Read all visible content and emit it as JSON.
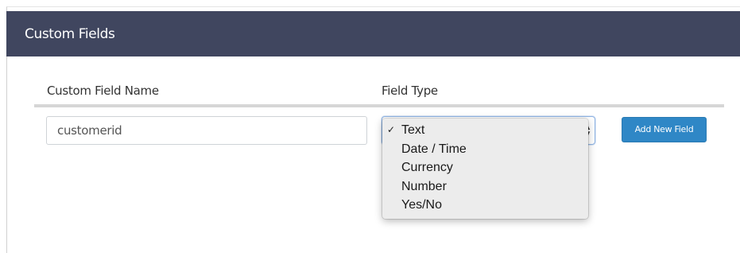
{
  "panel": {
    "title": "Custom Fields"
  },
  "table": {
    "headers": {
      "name": "Custom Field Name",
      "type": "Field Type"
    }
  },
  "row": {
    "name_value": "customerid",
    "add_button_label": "Add New Field"
  },
  "field_type_select": {
    "selected": "Text",
    "options": [
      "Text",
      "Date / Time",
      "Currency",
      "Number",
      "Yes/No"
    ],
    "check_glyph": "✓"
  },
  "colors": {
    "header_bg": "#40465f",
    "button_bg": "#2f87c6",
    "rule": "#d6d6d6"
  }
}
